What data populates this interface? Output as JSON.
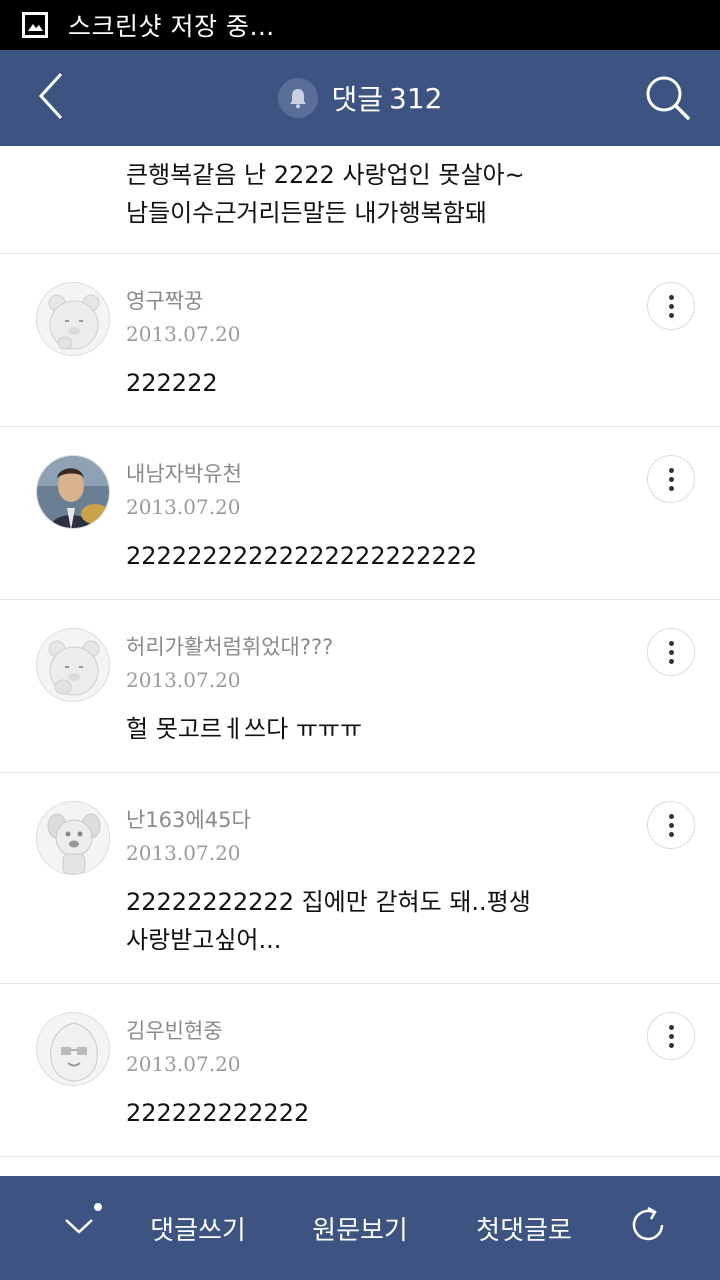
{
  "status_bar": {
    "text": "스크린샷 저장 중…",
    "icon": "image-icon"
  },
  "header": {
    "back_icon": "back-chevron-icon",
    "bell_icon": "bell-icon",
    "title": "댓글",
    "count": "312",
    "search_icon": "search-icon"
  },
  "partial_comment": {
    "text": "큰행복같음 난 2222 사랑업인 못살아~\n남들이수근거리든말든 내가행복함돼"
  },
  "comments": [
    {
      "author": "영구짝꿍",
      "date": "2013.07.20",
      "text": "222222",
      "avatar": "bear-character-avatar"
    },
    {
      "author": "내남자박유천",
      "date": "2013.07.20",
      "text": "22222222222222222222222",
      "avatar": "photo-avatar"
    },
    {
      "author": "허리가활처럼휘었대???",
      "date": "2013.07.20",
      "text": "헐 못고르ㅔ쓰다 ㅠㅠㅠ",
      "avatar": "bear-character-avatar"
    },
    {
      "author": "난163에45다",
      "date": "2013.07.20",
      "text": "22222222222 집에만 갇혀도 돼..평생\n사랑받고싶어...",
      "avatar": "dog-character-avatar"
    },
    {
      "author": "김우빈현중",
      "date": "2013.07.20",
      "text": "222222222222",
      "avatar": "peach-character-avatar"
    }
  ],
  "bottom_bar": {
    "collapse_icon": "chevron-down-icon",
    "write_label": "댓글쓰기",
    "origin_label": "원문보기",
    "first_label": "첫댓글로",
    "refresh_icon": "refresh-icon"
  },
  "colors": {
    "header_bg": "#3d5483",
    "status_bg": "#000000",
    "divider": "#e4e4e4"
  }
}
